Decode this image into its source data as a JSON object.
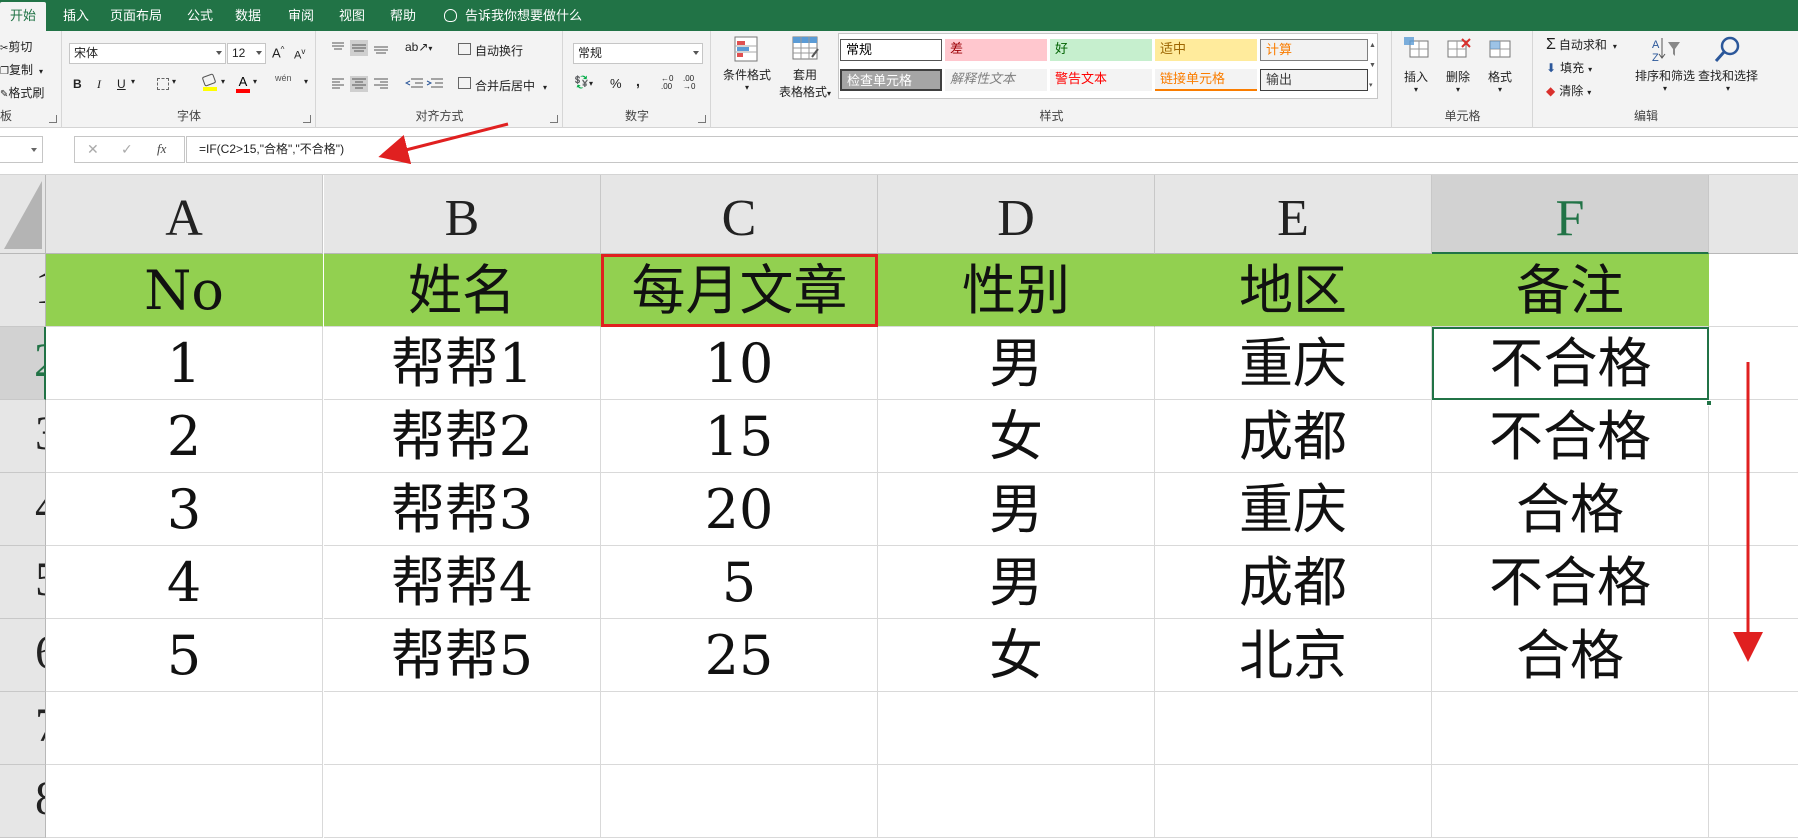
{
  "tabs": [
    {
      "label": "开始",
      "active": true
    },
    {
      "label": "插入"
    },
    {
      "label": "页面布局"
    },
    {
      "label": "公式"
    },
    {
      "label": "数据"
    },
    {
      "label": "审阅"
    },
    {
      "label": "视图"
    },
    {
      "label": "帮助"
    }
  ],
  "tell_me": "告诉我你想要做什么",
  "clipboard": {
    "cut": "剪切",
    "copy": "复制",
    "painter": "格式刷",
    "group": "板"
  },
  "font": {
    "name": "宋体",
    "size": "12",
    "group": "字体",
    "bold": "B",
    "italic": "I",
    "underline": "U",
    "grow": "A",
    "shrink": "A",
    "font_color": "A",
    "phonetic": "wén"
  },
  "alignment": {
    "wrap": "自动换行",
    "merge": "合并后居中",
    "group": "对齐方式"
  },
  "number": {
    "format": "常规",
    "group": "数字",
    "percent": "%",
    "comma": ","
  },
  "styles": {
    "conditional": "条件格式",
    "table_format_1": "套用",
    "table_format_2": "表格格式",
    "group": "样式",
    "cells": [
      {
        "label": "常规",
        "bg": "#ffffff",
        "fg": "#000000"
      },
      {
        "label": "差",
        "bg": "#ffc7ce",
        "fg": "#9c0006"
      },
      {
        "label": "好",
        "bg": "#c6efce",
        "fg": "#006100"
      },
      {
        "label": "适中",
        "bg": "#ffeb9c",
        "fg": "#9c6500"
      },
      {
        "label": "计算",
        "bg": "#f2f2f2",
        "fg": "#fa7d00"
      },
      {
        "label": "检查单元格",
        "bg": "#a5a5a5",
        "fg": "#ffffff"
      },
      {
        "label": "解释性文本",
        "bg": "#f3f3f3",
        "fg": "#7f7f7f"
      },
      {
        "label": "警告文本",
        "bg": "#f3f3f3",
        "fg": "#ff0000"
      },
      {
        "label": "链接单元格",
        "bg": "#f3f3f3",
        "fg": "#fa7d00"
      },
      {
        "label": "输出",
        "bg": "#f2f2f2",
        "fg": "#3f3f3f"
      }
    ]
  },
  "cells_group": {
    "insert": "插入",
    "delete": "删除",
    "format": "格式",
    "group": "单元格"
  },
  "editing": {
    "autosum": "自动求和",
    "fill": "填充",
    "clear": "清除",
    "sort": "排序和筛选",
    "find": "查找和选择",
    "group": "编辑"
  },
  "formula_bar": {
    "formula": "=IF(C2>15,\"合格\",\"不合格\")",
    "cancel": "✕",
    "enter": "✓",
    "fx": "fx"
  },
  "columns": [
    "A",
    "B",
    "C",
    "D",
    "E",
    "F"
  ],
  "selected_column": "F",
  "row_numbers": [
    "1",
    "2",
    "3",
    "4",
    "5",
    "6",
    "7",
    "8"
  ],
  "selected_row": "2",
  "table": {
    "headers": [
      "No",
      "姓名",
      "每月文章",
      "性别",
      "地区",
      "备注"
    ],
    "rows": [
      [
        "1",
        "帮帮1",
        "10",
        "男",
        "重庆",
        "不合格"
      ],
      [
        "2",
        "帮帮2",
        "15",
        "女",
        "成都",
        "不合格"
      ],
      [
        "3",
        "帮帮3",
        "20",
        "男",
        "重庆",
        "合格"
      ],
      [
        "4",
        "帮帮4",
        "5",
        "男",
        "成都",
        "不合格"
      ],
      [
        "5",
        "帮帮5",
        "25",
        "女",
        "北京",
        "合格"
      ]
    ]
  },
  "colors": {
    "excel_green": "#217346",
    "header_fill": "#92d050",
    "annotation_red": "#e02020",
    "selection": "#217346"
  }
}
